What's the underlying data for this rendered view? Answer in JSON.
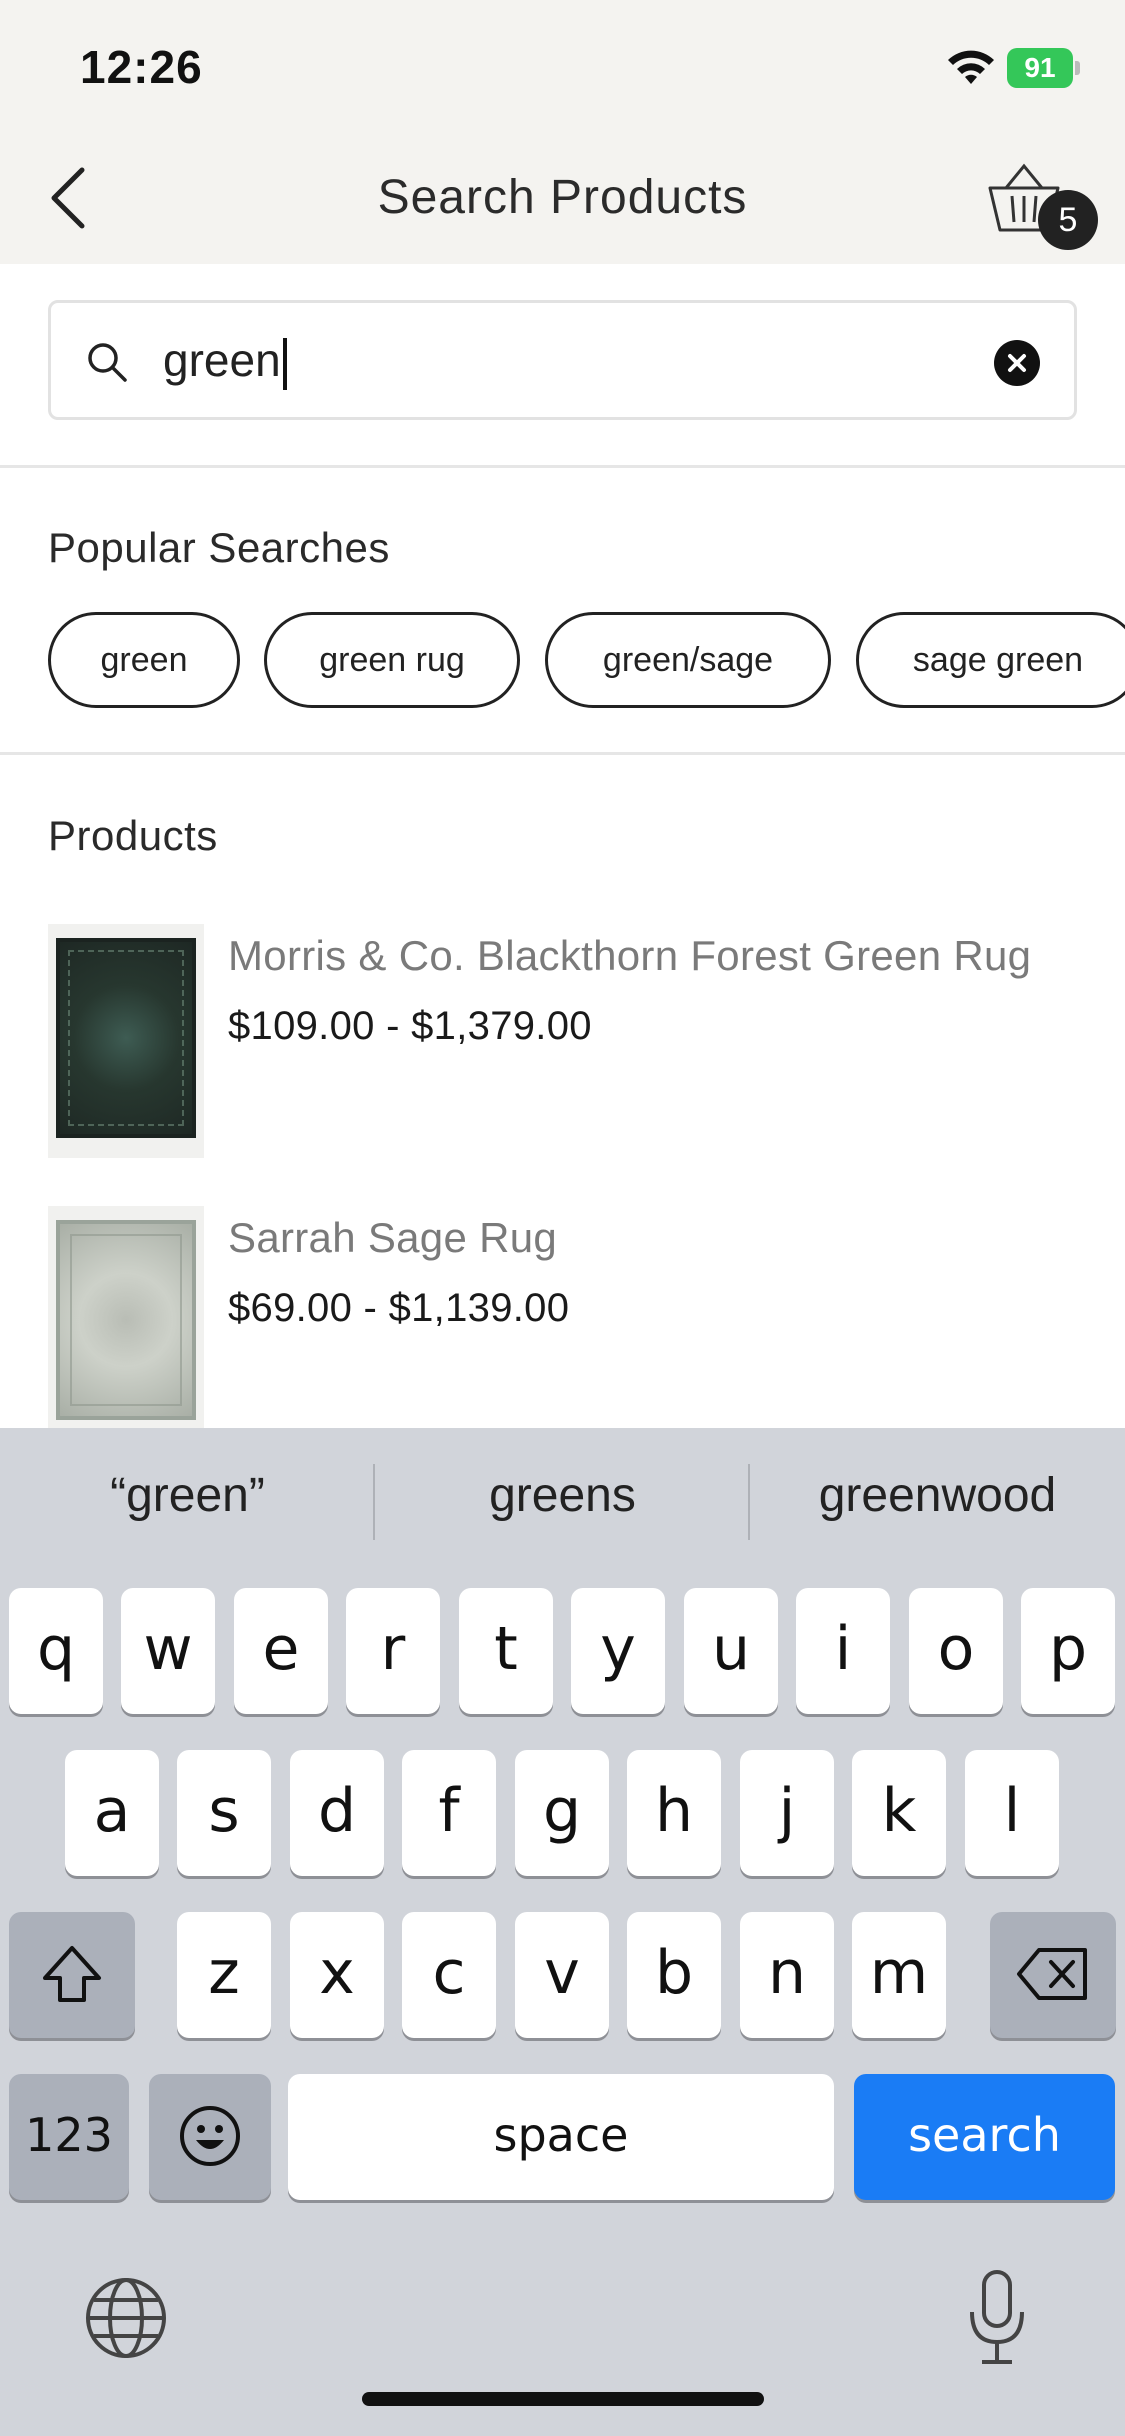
{
  "status_bar": {
    "time": "12:26",
    "battery": "91"
  },
  "header": {
    "title": "Search Products",
    "cart_count": "5"
  },
  "search": {
    "value": "green"
  },
  "popular": {
    "title": "Popular Searches",
    "chips": [
      "green",
      "green rug",
      "green/sage",
      "sage green"
    ]
  },
  "products": {
    "title": "Products",
    "items": [
      {
        "name": "Morris & Co. Blackthorn Forest Green Rug",
        "price": "$109.00 - $1,379.00"
      },
      {
        "name": "Sarrah Sage Rug",
        "price": "$69.00 - $1,139.00"
      }
    ]
  },
  "keyboard": {
    "suggestions": [
      "“green”",
      "greens",
      "greenwood"
    ],
    "row1": [
      "q",
      "w",
      "e",
      "r",
      "t",
      "y",
      "u",
      "i",
      "o",
      "p"
    ],
    "row2": [
      "a",
      "s",
      "d",
      "f",
      "g",
      "h",
      "j",
      "k",
      "l"
    ],
    "row3": [
      "z",
      "x",
      "c",
      "v",
      "b",
      "n",
      "m"
    ],
    "numbers_label": "123",
    "space_label": "space",
    "action_label": "search",
    "shift_icon": "shift-icon",
    "delete_icon": "backspace-icon",
    "emoji_icon": "emoji-icon",
    "globe_icon": "globe-icon",
    "mic_icon": "microphone-icon",
    "action_color": "#1a7cf5"
  }
}
